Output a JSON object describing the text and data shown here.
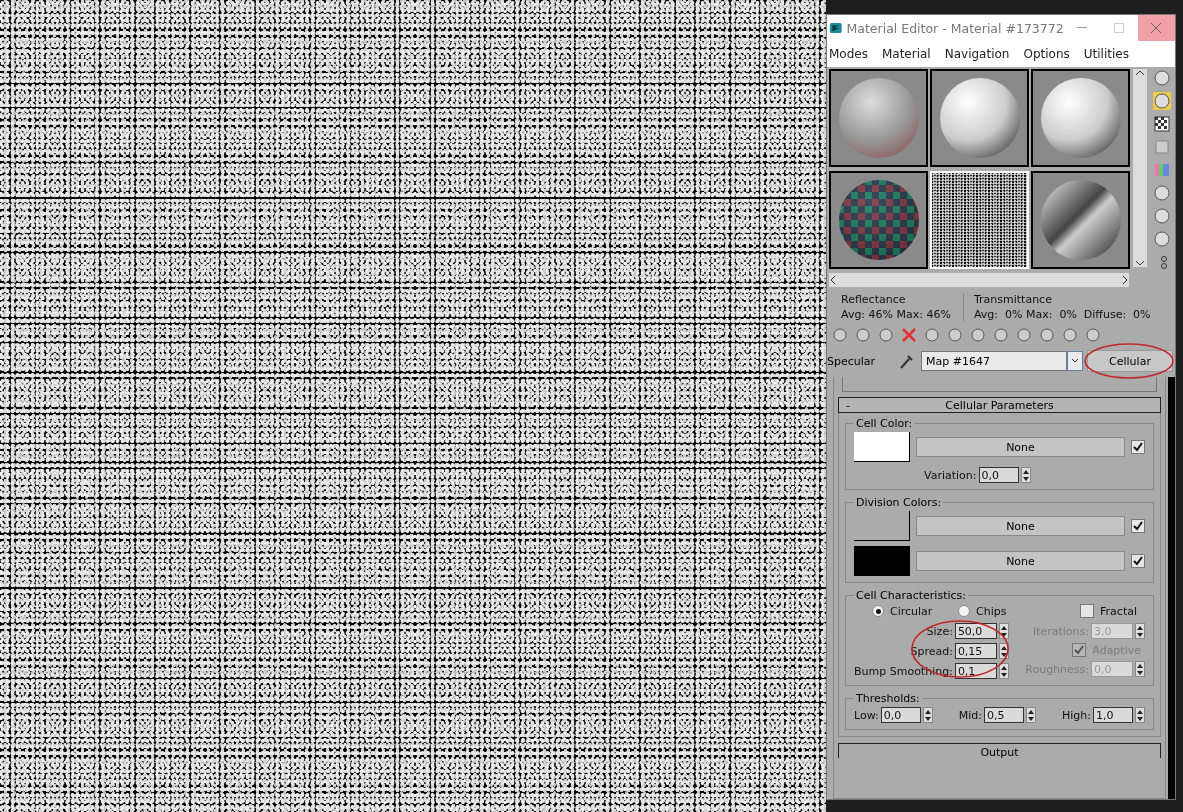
{
  "window": {
    "title": "Material Editor - Material #173772",
    "menu": [
      "Modes",
      "Material",
      "Navigation",
      "Options",
      "Utilities"
    ]
  },
  "slots": [
    {
      "kind": "glass",
      "selected": false
    },
    {
      "kind": "matte",
      "selected": false
    },
    {
      "kind": "matte",
      "selected": false
    },
    {
      "kind": "checker",
      "selected": false
    },
    {
      "kind": "noise",
      "selected": true
    },
    {
      "kind": "chrome",
      "selected": false
    }
  ],
  "stats": {
    "reflectance": {
      "label": "Reflectance",
      "values": "Avg: 46% Max: 46%"
    },
    "transmittance": {
      "label": "Transmittance",
      "values": "Avg:  0% Max:  0%  Diffuse:  0%"
    }
  },
  "map_row": {
    "label": "Specular",
    "map_name": "Map #1647",
    "map_type": "Cellular"
  },
  "rollout": {
    "toggle": "-",
    "title": "Cellular Parameters"
  },
  "cell_color": {
    "title": "Cell Color:",
    "color": "#ffffff",
    "map": "None",
    "checked": true,
    "variation_label": "Variation:",
    "variation": "0,0"
  },
  "division_colors": {
    "title": "Division Colors:",
    "rows": [
      {
        "color": "#ababab",
        "map": "None",
        "checked": true
      },
      {
        "color": "#000000",
        "map": "None",
        "checked": true
      }
    ]
  },
  "cell_characteristics": {
    "title": "Cell Characteristics:",
    "radios": [
      {
        "label": "Circular",
        "selected": true
      },
      {
        "label": "Chips",
        "selected": false
      }
    ],
    "fractal": {
      "label": "Fractal",
      "checked": false
    },
    "left_fields": [
      {
        "label": "Size:",
        "value": "50,0",
        "disabled": false
      },
      {
        "label": "Spread:",
        "value": "0,15",
        "disabled": false
      },
      {
        "label": "Bump Smoothing:",
        "value": "0,1",
        "disabled": false
      }
    ],
    "iterations": {
      "label": "Iterations:",
      "value": "3,0",
      "disabled": true
    },
    "adaptive": {
      "label": "Adaptive",
      "checked": true,
      "disabled": true
    },
    "roughness": {
      "label": "Roughness:",
      "value": "0,0",
      "disabled": true
    }
  },
  "thresholds": {
    "title": "Thresholds:",
    "fields": [
      {
        "label": "Low:",
        "value": "0,0"
      },
      {
        "label": "Mid:",
        "value": "0,5"
      },
      {
        "label": "High:",
        "value": "1,0"
      }
    ]
  },
  "next_rollout": {
    "title": "Output"
  }
}
